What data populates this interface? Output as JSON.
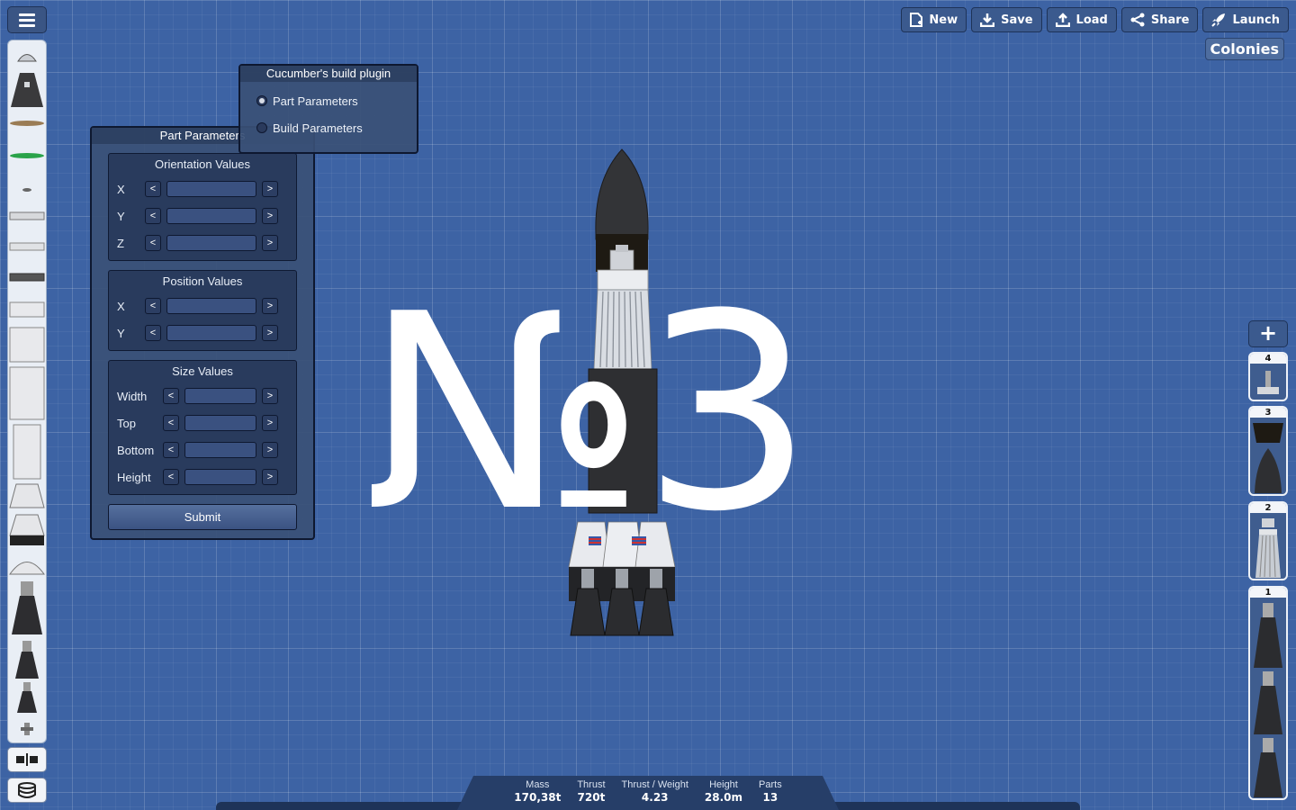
{
  "toolbar": {
    "new_label": "New",
    "save_label": "Save",
    "load_label": "Load",
    "share_label": "Share",
    "launch_label": "Launch",
    "colonies_label": "Colonies"
  },
  "plugin_window": {
    "title": "Cucumber's build plugin",
    "options": [
      {
        "label": "Part Parameters",
        "selected": true
      },
      {
        "label": "Build Parameters",
        "selected": false
      }
    ]
  },
  "part_parameters": {
    "title": "Part Parameters",
    "orientation": {
      "title": "Orientation Values",
      "rows": [
        "X",
        "Y",
        "Z"
      ]
    },
    "position": {
      "title": "Position Values",
      "rows": [
        "X",
        "Y"
      ]
    },
    "size": {
      "title": "Size Values",
      "rows": [
        "Width",
        "Top",
        "Bottom",
        "Height"
      ]
    },
    "arrow_left": "<",
    "arrow_right": ">",
    "submit_label": "Submit"
  },
  "overlay_text": "№3",
  "stages": {
    "add_label": "+",
    "items": [
      "4",
      "3",
      "2",
      "1"
    ]
  },
  "stats": {
    "mass_label": "Mass",
    "mass_value": "170,38t",
    "thrust_label": "Thrust",
    "thrust_value": "720t",
    "tw_label": "Thrust / Weight",
    "tw_value": "4.23",
    "height_label": "Height",
    "height_value": "28.0m",
    "parts_label": "Parts",
    "parts_value": "13"
  },
  "colors": {
    "background": "#3d63a4",
    "panel": "#3a5076",
    "button": "#3b5a8e"
  }
}
